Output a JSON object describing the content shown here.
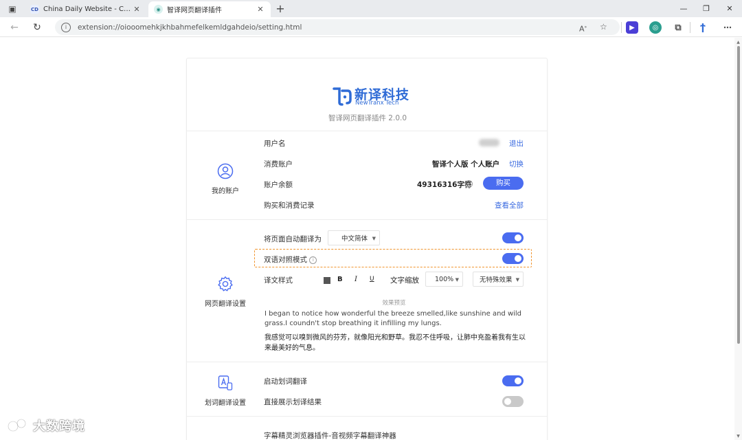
{
  "browser": {
    "tabs": [
      {
        "title": "China Daily Website - Connecting",
        "active": false
      },
      {
        "title": "智译网页翻译插件",
        "active": true
      }
    ],
    "url": "extension://oiooomehkjkhbahmefelkemldgahdeio/setting.html"
  },
  "header": {
    "brand_cn": "新译科技",
    "brand_en": "NewTranx Tech",
    "version": "智译网页翻译插件 2.0.0"
  },
  "account": {
    "section_label": "我的账户",
    "username_label": "用户名",
    "logout": "退出",
    "consumer_label": "消费账户",
    "consumer_value": "智译个人版 个人账户",
    "switch": "切换",
    "balance_label": "账户余额",
    "balance_value": "49316316字符",
    "buy": "购买",
    "records_label": "购买和消费记录",
    "view_all": "查看全部"
  },
  "webpage": {
    "section_label": "网页翻译设置",
    "auto_label": "将页面自动翻译为",
    "auto_lang": "中文简体",
    "auto_on": true,
    "bilingual_label": "双语对照模式",
    "bilingual_on": true,
    "style_label": "译文样式",
    "bold": "B",
    "italic": "I",
    "underline": "U",
    "scale_label": "文字缩放",
    "scale_value": "100%",
    "effect_value": "无特殊效果",
    "preview_title": "效果预览",
    "preview_en": "I began to notice how wonderful the breeze smelled,like sunshine and wild grass.I coundn't stop breathing it infilling my lungs.",
    "preview_cn": "我感觉可以嗅到微风的芬芳，就像阳光和野草。我忍不住呼吸，让肺中充盈着我有生以来最美好的气息。"
  },
  "selection": {
    "section_label": "划词翻译设置",
    "enable_label": "启动划词翻译",
    "enable_on": true,
    "direct_label": "直接展示划译结果",
    "direct_on": false
  },
  "footer_link": "字幕精灵浏览器插件-音视频字幕翻译神器",
  "watermark": "大数跨境",
  "colors": {
    "accent": "#4a6cf0",
    "brand": "#2f6bd6",
    "highlight": "#f0932b"
  }
}
